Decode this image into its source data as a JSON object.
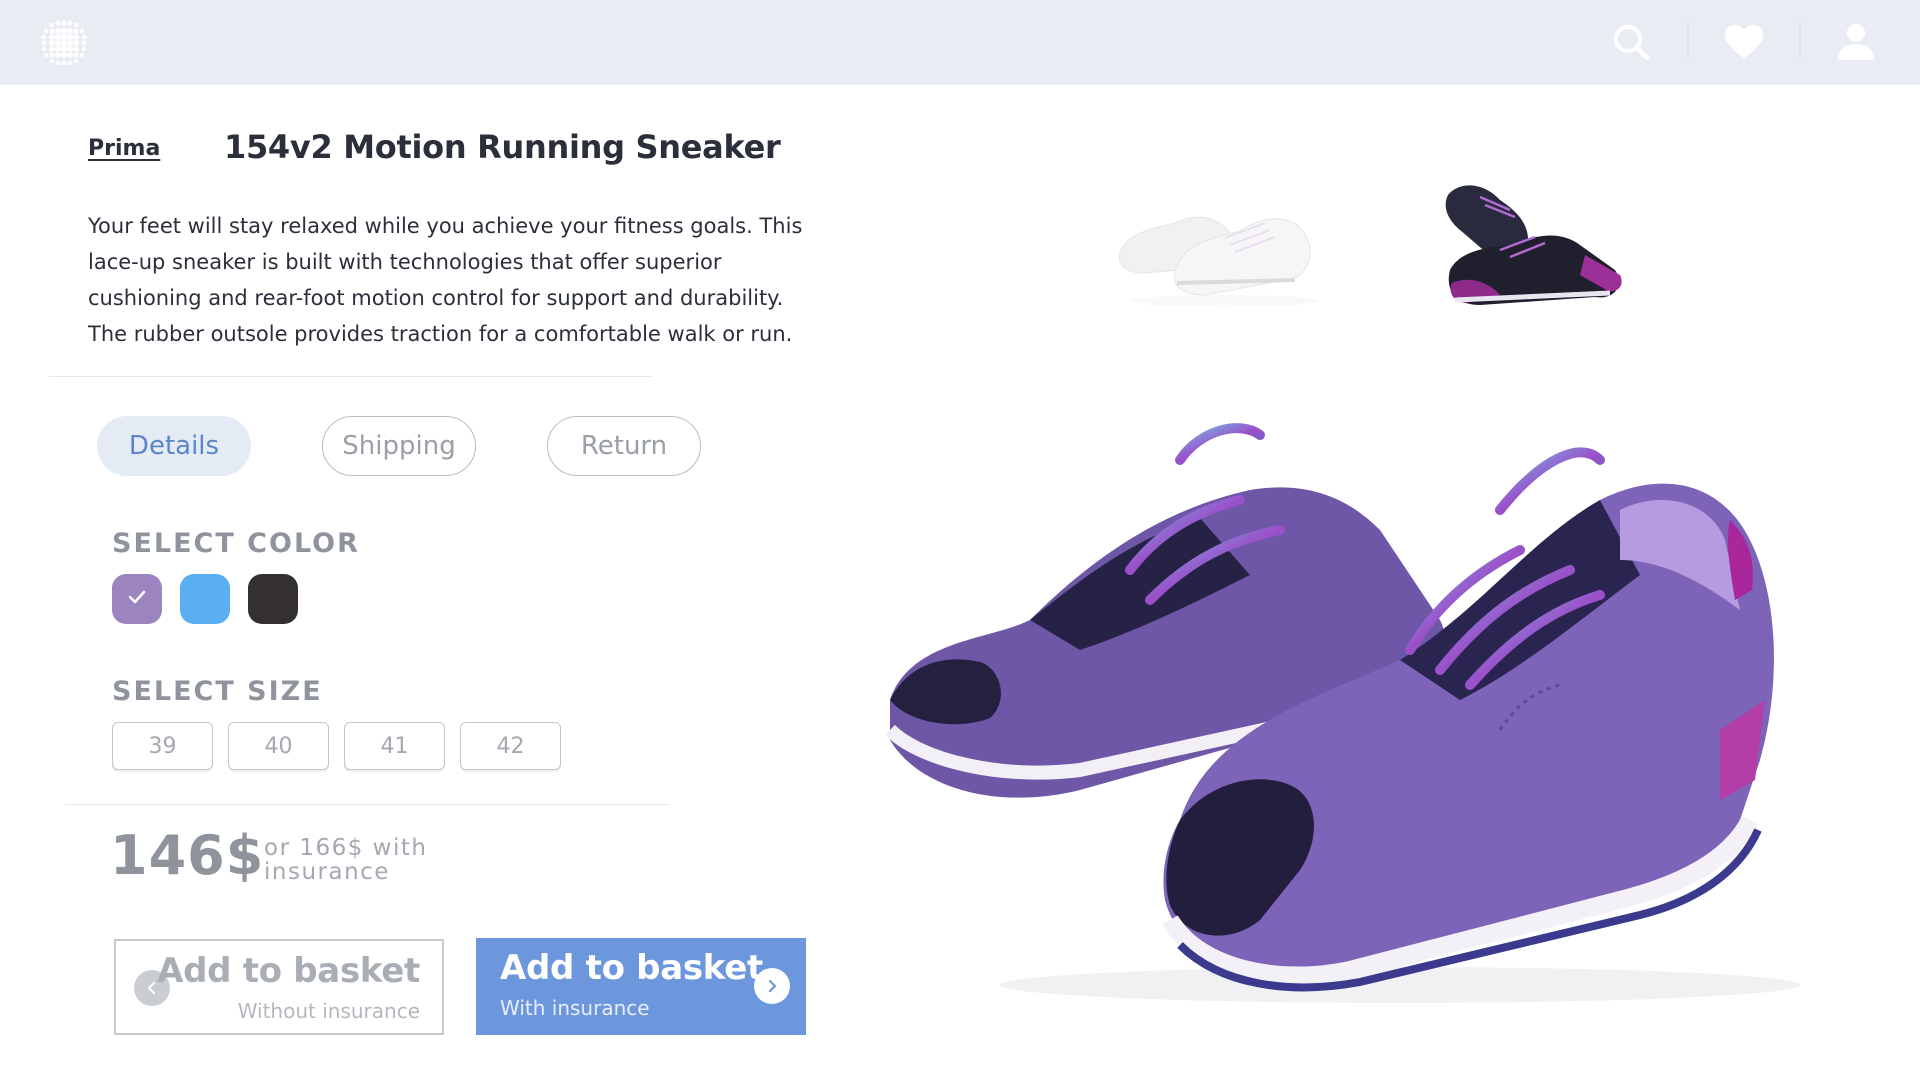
{
  "header": {
    "logo_icon": "dotted-logo-icon",
    "icons": [
      "search-icon",
      "heart-icon",
      "user-icon"
    ]
  },
  "product": {
    "brand": "Prima",
    "title": "154v2 Motion Running Sneaker",
    "description": "Your feet will stay relaxed while you achieve your fitness goals. This lace-up sneaker is built with technologies that offer superior cushioning and rear-foot motion control for support and durability. The rubber outsole provides traction for a comfortable walk or run."
  },
  "tabs": [
    {
      "label": "Details",
      "active": true
    },
    {
      "label": "Shipping",
      "active": false
    },
    {
      "label": "Return",
      "active": false
    }
  ],
  "color_section": {
    "label": "SELECT COLOR",
    "options": [
      {
        "color": "#9b84bf",
        "selected": true
      },
      {
        "color": "#5aaff0",
        "selected": false
      },
      {
        "color": "#33302f",
        "selected": false
      }
    ]
  },
  "size_section": {
    "label": "SELECT SIZE",
    "options": [
      "39",
      "40",
      "41",
      "42"
    ]
  },
  "pricing": {
    "price": "146$",
    "alt_price": "or 166$ with insurance"
  },
  "buttons": {
    "without": {
      "label": "Add to basket",
      "sub": "Without insurance"
    },
    "with": {
      "label": "Add to basket",
      "sub": "With insurance"
    }
  },
  "colors": {
    "topbar": "#e9edf3",
    "accent": "#6d97dc",
    "active_tab_bg": "#e4ebf5",
    "active_tab_text": "#5b86c9",
    "muted_text": "#8f949c"
  }
}
